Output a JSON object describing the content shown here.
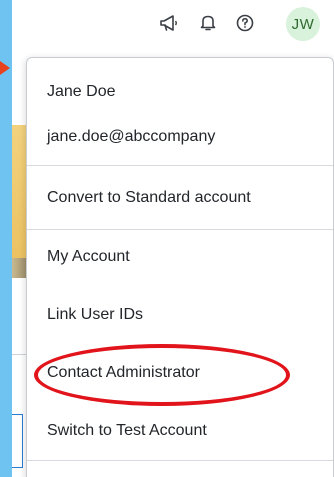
{
  "header": {
    "icons": [
      {
        "name": "announcements-icon"
      },
      {
        "name": "notifications-icon"
      },
      {
        "name": "help-icon"
      }
    ],
    "avatar_initials": "JW"
  },
  "account_menu": {
    "user_name": "Jane Doe",
    "user_email": "jane.doe@abccompany",
    "convert_label": "Convert to Standard account",
    "items": [
      {
        "label": "My Account"
      },
      {
        "label": "Link User IDs"
      },
      {
        "label": "Contact Administrator"
      },
      {
        "label": "Switch to Test Account"
      }
    ]
  },
  "colors": {
    "frame_blue": "#6ec3f0",
    "avatar_bg": "#d9f2dc",
    "avatar_text": "#2f6b2f",
    "highlight_red": "#e2141b",
    "arrow_orange": "#e9421f"
  }
}
